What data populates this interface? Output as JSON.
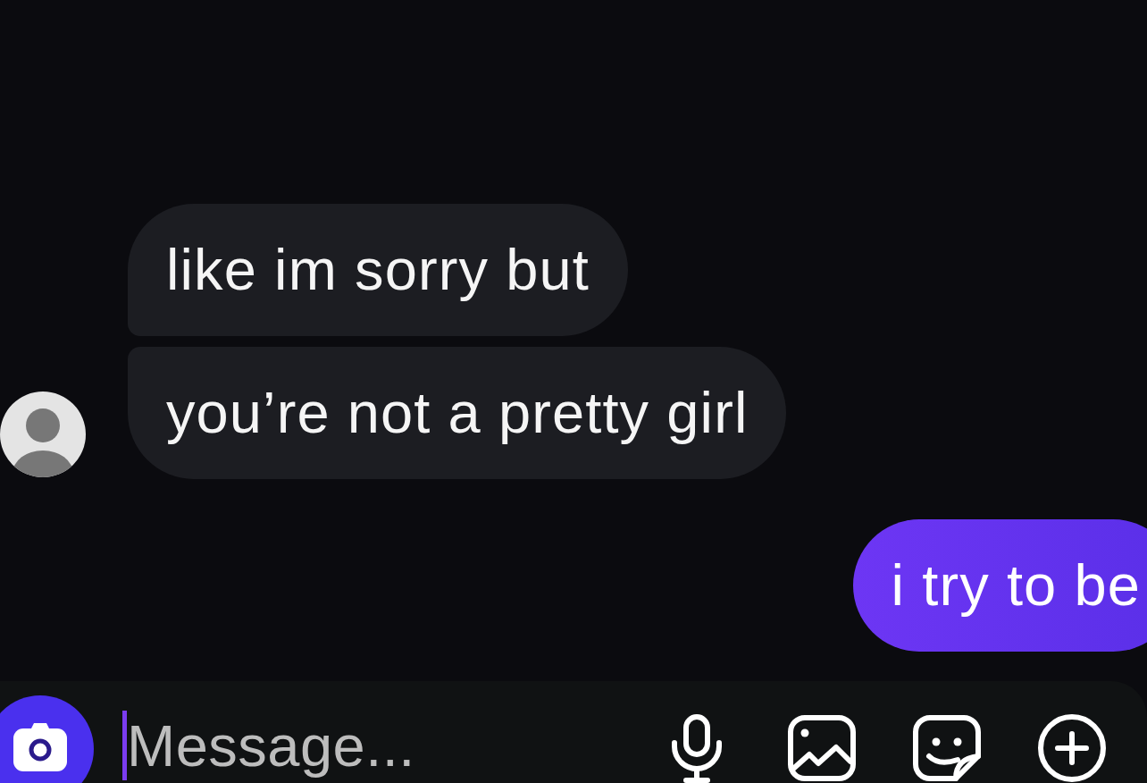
{
  "messages": [
    {
      "kind": "received",
      "text": "like im sorry but"
    },
    {
      "kind": "received",
      "text": "you’re not a pretty girl"
    },
    {
      "kind": "sent",
      "text": "i try to be"
    }
  ],
  "composer": {
    "placeholder": "Message..."
  }
}
